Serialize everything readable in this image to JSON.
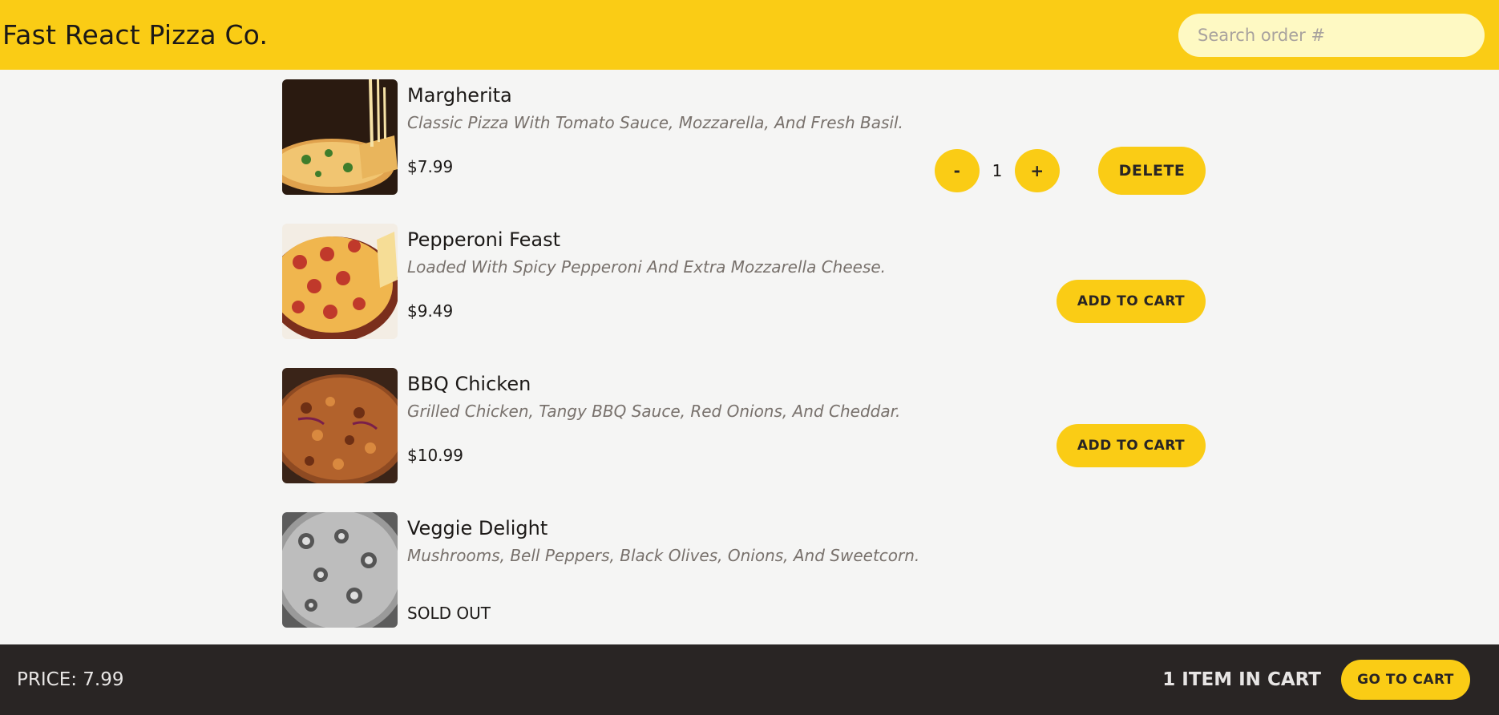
{
  "header": {
    "title": "Fast React Pizza Co.",
    "search_placeholder": "Search order #"
  },
  "menu": [
    {
      "name": "Margherita",
      "ingredients": "Classic Pizza With Tomato Sauce, Mozzarella, And Fresh Basil.",
      "price": "$7.99",
      "in_cart": true,
      "quantity": "1",
      "decrement_label": "-",
      "increment_label": "+",
      "delete_label": "DELETE",
      "image": "margherita-photo"
    },
    {
      "name": "Pepperoni Feast",
      "ingredients": "Loaded With Spicy Pepperoni And Extra Mozzarella Cheese.",
      "price": "$9.49",
      "add_label": "ADD TO CART",
      "image": "pepperoni-photo"
    },
    {
      "name": "BBQ Chicken",
      "ingredients": "Grilled Chicken, Tangy BBQ Sauce, Red Onions, And Cheddar.",
      "price": "$10.99",
      "add_label": "ADD TO CART",
      "image": "bbq-chicken-photo"
    },
    {
      "name": "Veggie Delight",
      "ingredients": "Mushrooms, Bell Peppers, Black Olives, Onions, And Sweetcorn.",
      "status": "SOLD OUT",
      "image": "veggie-photo-grayscale"
    }
  ],
  "footer": {
    "total": "PRICE: 7.99",
    "cart_count": "1 ITEM IN CART",
    "go_to_cart_label": "GO TO CART"
  },
  "colors": {
    "accent": "#facc15",
    "search_bg": "#fef9c3",
    "page_bg": "#f5f5f4",
    "footer_bg": "#292524",
    "muted_text": "#78716c"
  }
}
